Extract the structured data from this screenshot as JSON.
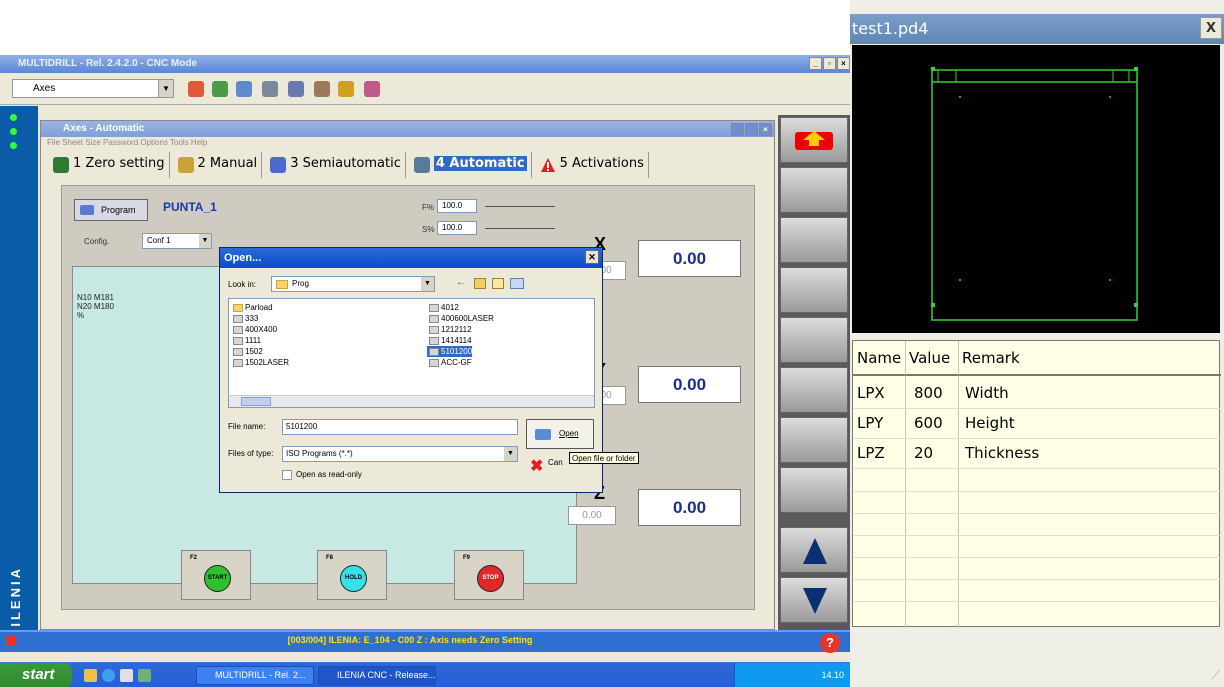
{
  "app": {
    "title": "MULTIDRILL - Rel. 2.4.2.0 - CNC Mode",
    "axes_combo": "Axes",
    "side_text": "ILENIA"
  },
  "inner_window": {
    "title": "Axes - Automatic",
    "menu": "File  Sheet  Size  Password  Options  Tools  Help",
    "tabs": [
      {
        "label": "1 Zero setting"
      },
      {
        "label": "2 Manual"
      },
      {
        "label": "3 Semiautomatic"
      },
      {
        "label": "4 Automatic",
        "active": true
      },
      {
        "label": "5 Activations"
      }
    ]
  },
  "panel": {
    "program_button": "Program",
    "program_name": "PUNTA_1",
    "config_label": "Config.",
    "config_value": "Conf 1",
    "feed_f_label": "F%",
    "feed_f_value": "100.0",
    "feed_s_label": "S%",
    "feed_s_value": "100.0",
    "program_lines": [
      "N10 M181",
      "N20 M180",
      "%"
    ],
    "axes": [
      {
        "name": "X",
        "sub": "0.00",
        "value": "0.00"
      },
      {
        "name": "Y",
        "sub": "0.00",
        "value": "0.00"
      },
      {
        "name": "Z",
        "sub": "0.00",
        "value": "0.00"
      }
    ],
    "fkeys": [
      {
        "key": "F2",
        "label": "START",
        "color": "#2ec02e"
      },
      {
        "key": "F8",
        "label": "HOLD",
        "color": "#35e0e8"
      },
      {
        "key": "F9",
        "label": "STOP",
        "color": "#e02a2a"
      }
    ]
  },
  "open_dialog": {
    "title": "Open...",
    "look_in_label": "Look in:",
    "look_in_value": "Prog",
    "files_left": [
      "Parload",
      "333",
      "400X400",
      "1111",
      "1502",
      "1502LASER"
    ],
    "files_right": [
      "4012",
      "400600LASER",
      "1212112",
      "1414114",
      "5101200",
      "ACC-GF"
    ],
    "selected_file": "5101200",
    "file_name_label": "File name:",
    "file_name_value": "5101200",
    "file_type_label": "Files of type:",
    "file_type_value": "ISO Programs (*.*)",
    "read_only_label": "Open as read-only",
    "open_button": "Open",
    "cancel_button": "Can",
    "tooltip": "Open file or folder"
  },
  "status": {
    "message": "[003/004] ILENIA: E_104 - C00 Z : Axis needs Zero Setting"
  },
  "taskbar": {
    "start": "start",
    "tasks": [
      "MULTIDRILL - Rel. 2...",
      "ILENIA CNC - Release..."
    ],
    "clock": "14.10"
  },
  "right_window": {
    "title": "test1.pd4",
    "close": "X",
    "table": {
      "headers": [
        "Name",
        "Value",
        "Remark"
      ],
      "rows": [
        {
          "name": "LPX",
          "value": "800",
          "remark": "Width"
        },
        {
          "name": "LPY",
          "value": "600",
          "remark": "Height"
        },
        {
          "name": "LPZ",
          "value": "20",
          "remark": "Thickness"
        }
      ]
    },
    "colors": {
      "canvas": "#000000",
      "drawing": "#35d035",
      "table_bg": "#ffffe8"
    }
  }
}
